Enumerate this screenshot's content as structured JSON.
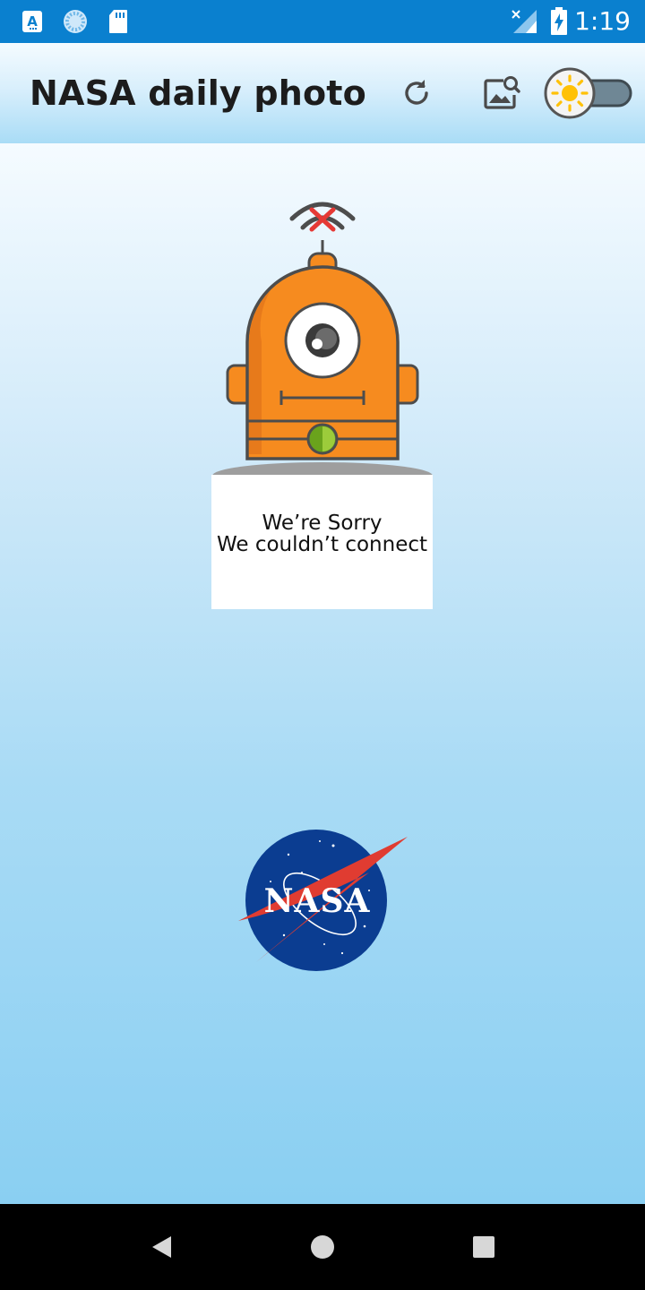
{
  "status_bar": {
    "time": "1:19",
    "left_icons": [
      "accessibility-a-icon",
      "sync-circle-icon",
      "sd-card-icon"
    ],
    "right_icons": [
      "signal-no-data-icon",
      "battery-charging-icon"
    ]
  },
  "app_bar": {
    "title": "NASA daily photo",
    "actions": [
      "refresh-icon",
      "image-search-icon"
    ],
    "theme_toggle": {
      "icon": "sun-icon",
      "state": "off"
    }
  },
  "error": {
    "illustration": "robot-no-signal",
    "line1": "We’re Sorry",
    "line2": "We couldn’t connect"
  },
  "logo": {
    "text": "NASA"
  },
  "colors": {
    "status_bar": "#0a80cf",
    "robot_orange": "#f68b1f",
    "nasa_blue": "#0b3d91",
    "nasa_red": "#e03c31",
    "sun": "#ffc107"
  },
  "nav_bar": {
    "buttons": [
      "back",
      "home",
      "recents"
    ]
  }
}
